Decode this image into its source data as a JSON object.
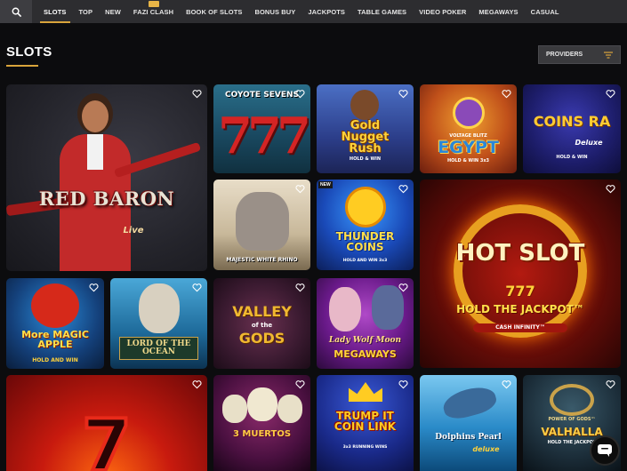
{
  "nav": {
    "items": [
      {
        "label": "SLOTS",
        "active": true
      },
      {
        "label": "TOP"
      },
      {
        "label": "NEW"
      },
      {
        "label": "FAZI CLASH",
        "badge": true
      },
      {
        "label": "BOOK OF SLOTS"
      },
      {
        "label": "BONUS BUY"
      },
      {
        "label": "JACKPOTS"
      },
      {
        "label": "TABLE GAMES"
      },
      {
        "label": "VIDEO POKER"
      },
      {
        "label": "MEGAWAYS"
      },
      {
        "label": "CASUAL"
      }
    ]
  },
  "page": {
    "title": "SLOTS"
  },
  "providers": {
    "label": "PROVIDERS"
  },
  "games": [
    {
      "title": "RED BARON",
      "sub": "Live"
    },
    {
      "title": "COYOTE SEVENS",
      "sub": "777"
    },
    {
      "title": "Gold Nugget Rush",
      "sub": "HOLD & WIN"
    },
    {
      "title": "EGYPT",
      "sub": "HOLD & WIN 3x3",
      "pre": "VOLTAGE BLITZ"
    },
    {
      "title": "COINS RA",
      "sub": "HOLD & WIN",
      "pre": "Deluxe"
    },
    {
      "title": "MAJESTIC WHITE RHINO"
    },
    {
      "title": "THUNDER COINS",
      "sub": "HOLD AND WIN 3x3",
      "pre": "NEW"
    },
    {
      "title": "HOT SLOT",
      "sub": "HOLD THE JACKPOT™",
      "pre": "777",
      "extra": "CASH INFINITY™"
    },
    {
      "title": "More MAGIC APPLE",
      "sub": "HOLD AND WIN"
    },
    {
      "title": "LORD OF THE OCEAN"
    },
    {
      "title": "VALLEY",
      "sub": "GODS",
      "pre": "of the"
    },
    {
      "title": "Lady Wolf Moon",
      "sub": "MEGAWAYS"
    },
    {
      "title": "7"
    },
    {
      "title": "3 MUERTOS"
    },
    {
      "title": "TRUMP IT COIN LINK",
      "sub": "3x3 RUNNING WINS"
    },
    {
      "title": "Dolphins Pearl",
      "sub": "deluxe"
    },
    {
      "title": "VALHALLA",
      "sub": "HOLD THE JACKPOT",
      "pre": "POWER OF GODS™"
    }
  ],
  "icons": {
    "search": "search-icon",
    "heart": "heart-icon",
    "filter": "filter-icon",
    "chat": "chat-icon"
  },
  "colors": {
    "accent": "#d9a43b",
    "nav_bg": "#2d2d30",
    "page_bg": "#0c0c0e"
  }
}
